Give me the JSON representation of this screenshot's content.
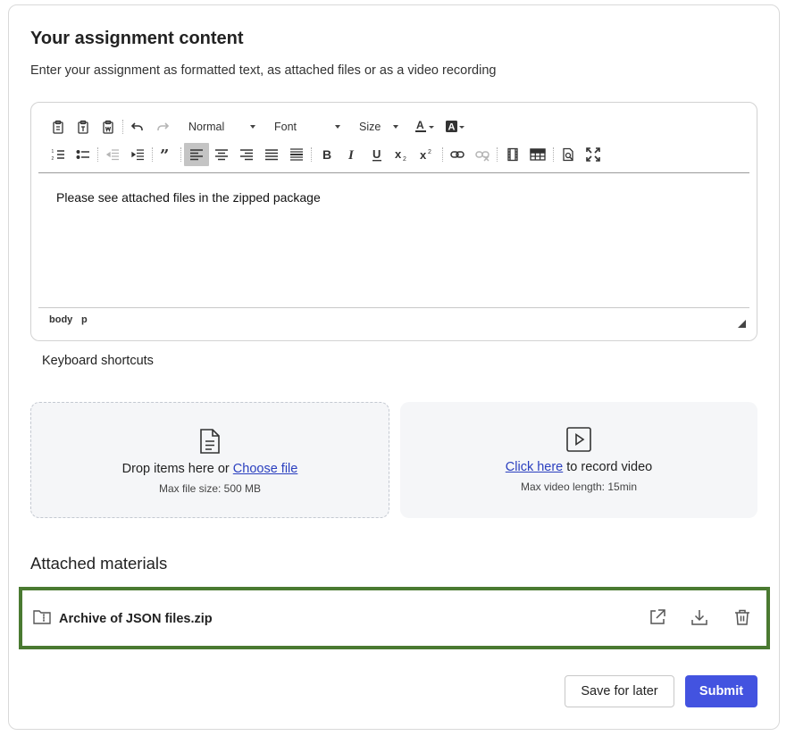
{
  "section": {
    "title": "Your assignment content",
    "subtitle": "Enter your assignment as formatted text, as attached files or as a video recording"
  },
  "editor": {
    "format_value": "Normal",
    "font_value": "Font",
    "size_value": "Size",
    "body_text": "Please see attached files in the zipped package",
    "path": [
      "body",
      "p"
    ]
  },
  "keyboard_shortcuts": "Keyboard shortcuts",
  "upload": {
    "drop_text": "Drop items here or ",
    "choose_file": "Choose file",
    "max_size": "Max file size: 500 MB"
  },
  "video": {
    "click_here": "Click here",
    "record_text": " to record video",
    "max_length": "Max video length: 15min"
  },
  "attached": {
    "title": "Attached materials",
    "items": [
      {
        "name": "Archive of JSON files.zip",
        "icon": "folder-zip-icon"
      }
    ]
  },
  "actions": {
    "save_label": "Save for later",
    "submit_label": "Submit"
  },
  "colors": {
    "primary": "#4353e0",
    "highlight_border": "#4a7a31",
    "link": "#2a3fbf"
  }
}
